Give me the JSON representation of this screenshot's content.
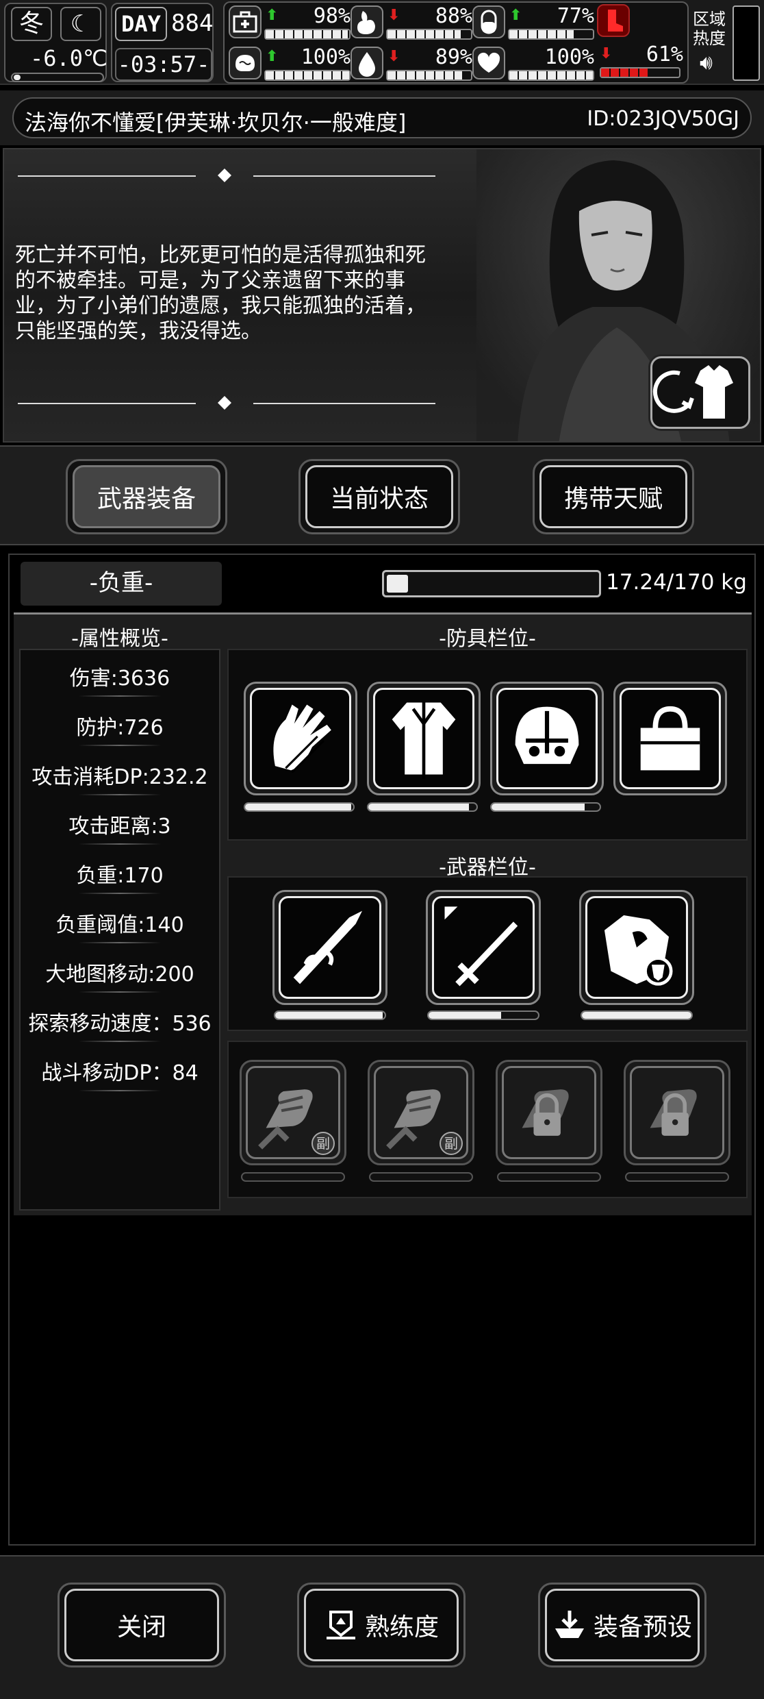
{
  "status_bar": {
    "season": "冬",
    "temperature": "-6.0℃",
    "day_label": "DAY",
    "day_number": "884",
    "clock": "-03:57-",
    "stats": [
      {
        "icon": "medkit-icon",
        "trend": "up",
        "value": "98%",
        "level": 0.98
      },
      {
        "icon": "stomach-icon",
        "trend": "down",
        "value": "88%",
        "level": 0.88
      },
      {
        "icon": "pill-icon",
        "trend": "up",
        "value": "77%",
        "level": 0.77
      },
      {
        "icon": "brain-icon",
        "trend": "up",
        "value": "100%",
        "level": 1.0
      },
      {
        "icon": "water-drop-icon",
        "trend": "down",
        "value": "89%",
        "level": 0.89
      },
      {
        "icon": "heart-icon",
        "trend": "none",
        "value": "100%",
        "level": 1.0
      },
      {
        "icon": "boot-icon",
        "trend": "down",
        "value": "61%",
        "level": 0.61,
        "alert": true
      }
    ],
    "zone_label": "区域热度"
  },
  "title": {
    "save_name": "法海你不懂爱[伊芙琳·坎贝尔·一般难度]",
    "player_id": "ID:023JQV50GJ"
  },
  "story": {
    "quote": "死亡并不可怕，比死更可怕的是活得孤独和死的不被牵挂。可是，为了父亲遗留下来的事业，为了小弟们的遗愿，我只能孤独的活着，只能坚强的笑，我没得选。"
  },
  "tabs": [
    {
      "label": "武器装备",
      "active": true
    },
    {
      "label": "当前状态",
      "active": false
    },
    {
      "label": "携带天赋",
      "active": false
    }
  ],
  "weight": {
    "label": "-负重-",
    "value": "17.24/170 kg",
    "ratio": 0.1014
  },
  "attributes": {
    "title": "-属性概览-",
    "items": [
      "伤害:3636",
      "防护:726",
      "攻击消耗DP:232.2",
      "攻击距离:3",
      "负重:170",
      "负重阈值:140",
      "大地图移动:200",
      "探索移动速度：536",
      "战斗移动DP：84"
    ]
  },
  "armor": {
    "title": "-防具栏位-",
    "slots": [
      {
        "icon": "gloves-icon",
        "durability": 0.98
      },
      {
        "icon": "coat-icon",
        "durability": 0.93
      },
      {
        "icon": "helmet-icon",
        "durability": 0.86
      },
      {
        "icon": "bag-icon",
        "durability": null
      }
    ]
  },
  "weapons": {
    "title": "-武器栏位-",
    "slots": [
      {
        "icon": "spear-icon",
        "durability": 0.98
      },
      {
        "icon": "sword-icon",
        "durability": 0.66
      },
      {
        "icon": "shield-icon",
        "durability": 1.0
      }
    ]
  },
  "extra_slots": [
    {
      "icon": "fist-icon",
      "badge": "副",
      "locked": false
    },
    {
      "icon": "fist-icon",
      "badge": "副",
      "locked": false
    },
    {
      "icon": "lock-icon",
      "badge": "",
      "locked": true
    },
    {
      "icon": "lock-icon",
      "badge": "",
      "locked": true
    }
  ],
  "bottom": {
    "close": "关闭",
    "proficiency": "熟练度",
    "preset": "装备预设"
  }
}
